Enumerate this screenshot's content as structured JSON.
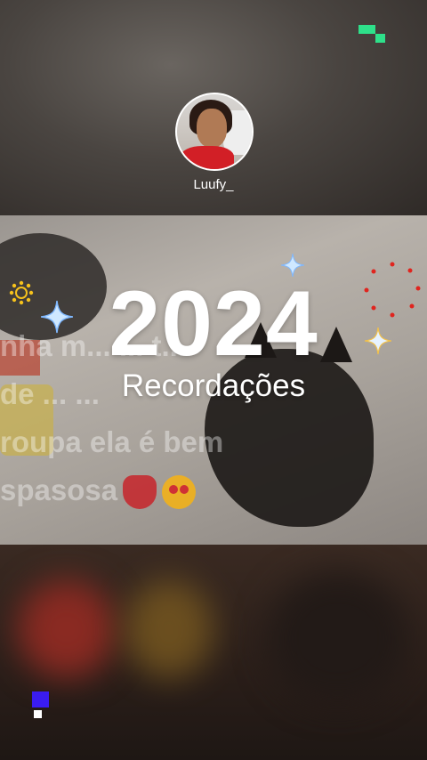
{
  "profile": {
    "username": "Luufy_"
  },
  "title": {
    "year": "2024",
    "subtitle": "Recordações"
  },
  "background_comment": {
    "lines": [
      "nha m... ... t...",
      "de ... ...",
      "roupa ela é bem",
      "spasosa"
    ]
  },
  "icons": {
    "top_logo": "green-pixel-logo-icon",
    "bottom_logo": "blue-pixel-logo-icon",
    "sparkles": [
      "sparkle-icon",
      "sparkle-icon",
      "sparkle-icon"
    ],
    "sun": "yellow-sun-icon",
    "dots": "red-dot-ring-icon"
  },
  "colors": {
    "accent_green": "#2ee08a",
    "accent_blue": "#3a1cf0",
    "text": "#ffffff"
  }
}
